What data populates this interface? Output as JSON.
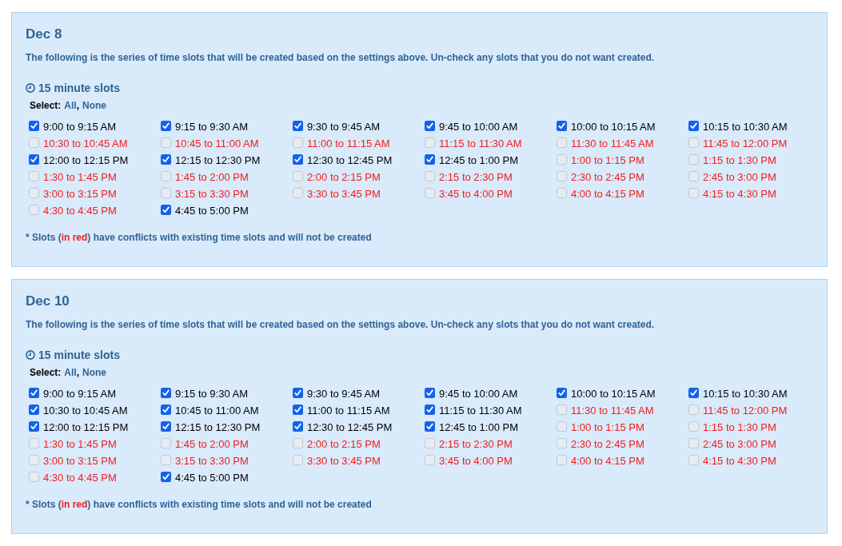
{
  "panels": [
    {
      "date": "Dec 8",
      "description": "The following is the series of time slots that will be created based on the settings above. Un-check any slots that you do not want created.",
      "slot_group": {
        "title": "15 minute slots",
        "select": {
          "label": "Select:",
          "links": [
            {
              "label": "All"
            },
            {
              "label": "None"
            }
          ],
          "separator": ","
        },
        "slots": [
          {
            "label": "9:00 to 9:15 AM",
            "checked": true,
            "disabled": false
          },
          {
            "label": "9:15 to 9:30 AM",
            "checked": true,
            "disabled": false
          },
          {
            "label": "9:30 to 9:45 AM",
            "checked": true,
            "disabled": false
          },
          {
            "label": "9:45 to 10:00 AM",
            "checked": true,
            "disabled": false
          },
          {
            "label": "10:00 to 10:15 AM",
            "checked": true,
            "disabled": false
          },
          {
            "label": "10:15 to 10:30 AM",
            "checked": true,
            "disabled": false
          },
          {
            "label": "10:30 to 10:45 AM",
            "checked": false,
            "disabled": true
          },
          {
            "label": "10:45 to 11:00 AM",
            "checked": false,
            "disabled": true
          },
          {
            "label": "11:00 to 11:15 AM",
            "checked": false,
            "disabled": true
          },
          {
            "label": "11:15 to 11:30 AM",
            "checked": false,
            "disabled": true
          },
          {
            "label": "11:30 to 11:45 AM",
            "checked": false,
            "disabled": true
          },
          {
            "label": "11:45 to 12:00 PM",
            "checked": false,
            "disabled": true
          },
          {
            "label": "12:00 to 12:15 PM",
            "checked": true,
            "disabled": false
          },
          {
            "label": "12:15 to 12:30 PM",
            "checked": true,
            "disabled": false
          },
          {
            "label": "12:30 to 12:45 PM",
            "checked": true,
            "disabled": false
          },
          {
            "label": "12:45 to 1:00 PM",
            "checked": true,
            "disabled": false
          },
          {
            "label": "1:00 to 1:15 PM",
            "checked": false,
            "disabled": true
          },
          {
            "label": "1:15 to 1:30 PM",
            "checked": false,
            "disabled": true
          },
          {
            "label": "1:30 to 1:45 PM",
            "checked": false,
            "disabled": true
          },
          {
            "label": "1:45 to 2:00 PM",
            "checked": false,
            "disabled": true
          },
          {
            "label": "2:00 to 2:15 PM",
            "checked": false,
            "disabled": true
          },
          {
            "label": "2:15 to 2:30 PM",
            "checked": false,
            "disabled": true
          },
          {
            "label": "2:30 to 2:45 PM",
            "checked": false,
            "disabled": true
          },
          {
            "label": "2:45 to 3:00 PM",
            "checked": false,
            "disabled": true
          },
          {
            "label": "3:00 to 3:15 PM",
            "checked": false,
            "disabled": true
          },
          {
            "label": "3:15 to 3:30 PM",
            "checked": false,
            "disabled": true
          },
          {
            "label": "3:30 to 3:45 PM",
            "checked": false,
            "disabled": true
          },
          {
            "label": "3:45 to 4:00 PM",
            "checked": false,
            "disabled": true
          },
          {
            "label": "4:00 to 4:15 PM",
            "checked": false,
            "disabled": true
          },
          {
            "label": "4:15 to 4:30 PM",
            "checked": false,
            "disabled": true
          },
          {
            "label": "4:30 to 4:45 PM",
            "checked": false,
            "disabled": true
          },
          {
            "label": "4:45 to 5:00 PM",
            "checked": true,
            "disabled": false
          }
        ]
      },
      "note": [
        {
          "text": "* Slots (",
          "kind": "plain"
        },
        {
          "text": "in red",
          "kind": "conflict"
        },
        {
          "text": ") have conflicts with existing time slots and will not be created",
          "kind": "plain"
        }
      ]
    },
    {
      "date": "Dec 10",
      "description": "The following is the series of time slots that will be created based on the settings above. Un-check any slots that you do not want created.",
      "slot_group": {
        "title": "15 minute slots",
        "select": {
          "label": "Select:",
          "links": [
            {
              "label": "All"
            },
            {
              "label": "None"
            }
          ],
          "separator": ","
        },
        "slots": [
          {
            "label": "9:00 to 9:15 AM",
            "checked": true,
            "disabled": false
          },
          {
            "label": "9:15 to 9:30 AM",
            "checked": true,
            "disabled": false
          },
          {
            "label": "9:30 to 9:45 AM",
            "checked": true,
            "disabled": false
          },
          {
            "label": "9:45 to 10:00 AM",
            "checked": true,
            "disabled": false
          },
          {
            "label": "10:00 to 10:15 AM",
            "checked": true,
            "disabled": false
          },
          {
            "label": "10:15 to 10:30 AM",
            "checked": true,
            "disabled": false
          },
          {
            "label": "10:30 to 10:45 AM",
            "checked": true,
            "disabled": false
          },
          {
            "label": "10:45 to 11:00 AM",
            "checked": true,
            "disabled": false
          },
          {
            "label": "11:00 to 11:15 AM",
            "checked": true,
            "disabled": false
          },
          {
            "label": "11:15 to 11:30 AM",
            "checked": true,
            "disabled": false
          },
          {
            "label": "11:30 to 11:45 AM",
            "checked": false,
            "disabled": true
          },
          {
            "label": "11:45 to 12:00 PM",
            "checked": false,
            "disabled": true
          },
          {
            "label": "12:00 to 12:15 PM",
            "checked": true,
            "disabled": false
          },
          {
            "label": "12:15 to 12:30 PM",
            "checked": true,
            "disabled": false
          },
          {
            "label": "12:30 to 12:45 PM",
            "checked": true,
            "disabled": false
          },
          {
            "label": "12:45 to 1:00 PM",
            "checked": true,
            "disabled": false
          },
          {
            "label": "1:00 to 1:15 PM",
            "checked": false,
            "disabled": true
          },
          {
            "label": "1:15 to 1:30 PM",
            "checked": false,
            "disabled": true
          },
          {
            "label": "1:30 to 1:45 PM",
            "checked": false,
            "disabled": true
          },
          {
            "label": "1:45 to 2:00 PM",
            "checked": false,
            "disabled": true
          },
          {
            "label": "2:00 to 2:15 PM",
            "checked": false,
            "disabled": true
          },
          {
            "label": "2:15 to 2:30 PM",
            "checked": false,
            "disabled": true
          },
          {
            "label": "2:30 to 2:45 PM",
            "checked": false,
            "disabled": true
          },
          {
            "label": "2:45 to 3:00 PM",
            "checked": false,
            "disabled": true
          },
          {
            "label": "3:00 to 3:15 PM",
            "checked": false,
            "disabled": true
          },
          {
            "label": "3:15 to 3:30 PM",
            "checked": false,
            "disabled": true
          },
          {
            "label": "3:30 to 3:45 PM",
            "checked": false,
            "disabled": true
          },
          {
            "label": "3:45 to 4:00 PM",
            "checked": false,
            "disabled": true
          },
          {
            "label": "4:00 to 4:15 PM",
            "checked": false,
            "disabled": true
          },
          {
            "label": "4:15 to 4:30 PM",
            "checked": false,
            "disabled": true
          },
          {
            "label": "4:30 to 4:45 PM",
            "checked": false,
            "disabled": true
          },
          {
            "label": "4:45 to 5:00 PM",
            "checked": true,
            "disabled": false
          }
        ]
      },
      "note": [
        {
          "text": "* Slots (",
          "kind": "plain"
        },
        {
          "text": "in red",
          "kind": "conflict"
        },
        {
          "text": ") have conflicts with existing time slots and will not be created",
          "kind": "plain"
        }
      ]
    }
  ]
}
